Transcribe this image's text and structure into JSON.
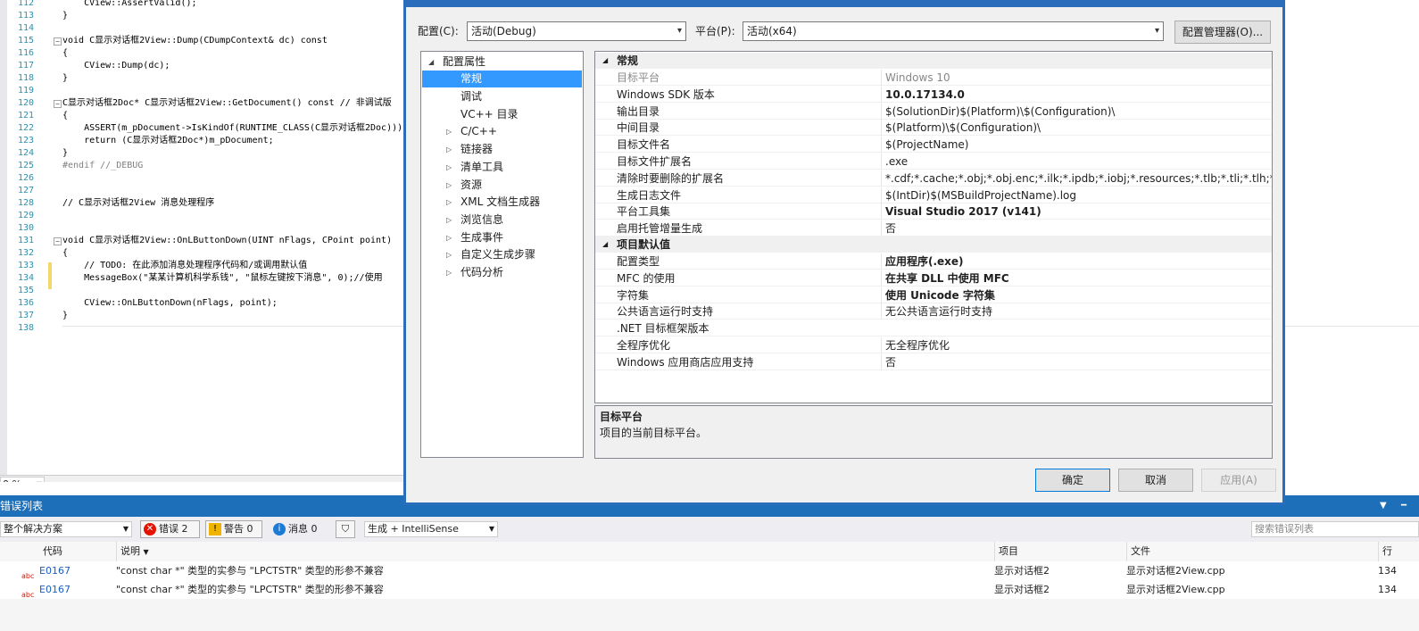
{
  "editor": {
    "lines": [
      {
        "n": "112",
        "t": "    CView::AssertValid();"
      },
      {
        "n": "113",
        "t": "}"
      },
      {
        "n": "114",
        "t": ""
      },
      {
        "n": "115",
        "t": "void C显示对话框2View::Dump(CDumpContext& dc) const"
      },
      {
        "n": "116",
        "t": "{"
      },
      {
        "n": "117",
        "t": "    CView::Dump(dc);"
      },
      {
        "n": "118",
        "t": "}"
      },
      {
        "n": "119",
        "t": ""
      },
      {
        "n": "120",
        "t": "C显示对话框2Doc* C显示对话框2View::GetDocument() const // 非调试版"
      },
      {
        "n": "121",
        "t": "{"
      },
      {
        "n": "122",
        "t": "    ASSERT(m_pDocument->IsKindOf(RUNTIME_CLASS(C显示对话框2Doc)));"
      },
      {
        "n": "123",
        "t": "    return (C显示对话框2Doc*)m_pDocument;"
      },
      {
        "n": "124",
        "t": "}"
      },
      {
        "n": "125",
        "t": "#endif //_DEBUG"
      },
      {
        "n": "126",
        "t": ""
      },
      {
        "n": "127",
        "t": ""
      },
      {
        "n": "128",
        "t": "// C显示对话框2View 消息处理程序"
      },
      {
        "n": "129",
        "t": ""
      },
      {
        "n": "130",
        "t": ""
      },
      {
        "n": "131",
        "t": "void C显示对话框2View::OnLButtonDown(UINT nFlags, CPoint point)"
      },
      {
        "n": "132",
        "t": "{"
      },
      {
        "n": "133",
        "t": "    // TODO: 在此添加消息处理程序代码和/或调用默认值"
      },
      {
        "n": "134",
        "t": "    MessageBox(\"某某计算机科学系钱\", \"鼠标左键按下消息\", 0);//使用"
      },
      {
        "n": "135",
        "t": ""
      },
      {
        "n": "136",
        "t": "    CView::OnLButtonDown(nFlags, point);"
      },
      {
        "n": "137",
        "t": "}"
      },
      {
        "n": "138",
        "t": ""
      }
    ],
    "zoom": "0 %"
  },
  "dialog": {
    "config_label": "配置(C):",
    "config_value": "活动(Debug)",
    "platform_label": "平台(P):",
    "platform_value": "活动(x64)",
    "config_manager": "配置管理器(O)...",
    "tree": [
      {
        "label": "配置属性",
        "level": 0,
        "expander": "◢"
      },
      {
        "label": "常规",
        "level": 1,
        "selected": true
      },
      {
        "label": "调试",
        "level": 1
      },
      {
        "label": "VC++ 目录",
        "level": 1
      },
      {
        "label": "C/C++",
        "level": 1,
        "expander": "▷"
      },
      {
        "label": "链接器",
        "level": 1,
        "expander": "▷"
      },
      {
        "label": "清单工具",
        "level": 1,
        "expander": "▷"
      },
      {
        "label": "资源",
        "level": 1,
        "expander": "▷"
      },
      {
        "label": "XML 文档生成器",
        "level": 1,
        "expander": "▷"
      },
      {
        "label": "浏览信息",
        "level": 1,
        "expander": "▷"
      },
      {
        "label": "生成事件",
        "level": 1,
        "expander": "▷"
      },
      {
        "label": "自定义生成步骤",
        "level": 1,
        "expander": "▷"
      },
      {
        "label": "代码分析",
        "level": 1,
        "expander": "▷"
      }
    ],
    "sections": [
      {
        "title": "常规",
        "rows": [
          {
            "name": "目标平台",
            "value": "Windows 10",
            "grey": true
          },
          {
            "name": "Windows SDK 版本",
            "value": "10.0.17134.0",
            "bold": true
          },
          {
            "name": "输出目录",
            "value": "$(SolutionDir)$(Platform)\\$(Configuration)\\"
          },
          {
            "name": "中间目录",
            "value": "$(Platform)\\$(Configuration)\\"
          },
          {
            "name": "目标文件名",
            "value": "$(ProjectName)"
          },
          {
            "name": "目标文件扩展名",
            "value": ".exe"
          },
          {
            "name": "清除时要删除的扩展名",
            "value": "*.cdf;*.cache;*.obj;*.obj.enc;*.ilk;*.ipdb;*.iobj;*.resources;*.tlb;*.tli;*.tlh;*.tmp;*.rs"
          },
          {
            "name": "生成日志文件",
            "value": "$(IntDir)$(MSBuildProjectName).log"
          },
          {
            "name": "平台工具集",
            "value": "Visual Studio 2017 (v141)",
            "bold": true
          },
          {
            "name": "启用托管增量生成",
            "value": "否"
          }
        ]
      },
      {
        "title": "项目默认值",
        "rows": [
          {
            "name": "配置类型",
            "value": "应用程序(.exe)",
            "bold": true
          },
          {
            "name": "MFC 的使用",
            "value": "在共享 DLL 中使用 MFC",
            "bold": true
          },
          {
            "name": "字符集",
            "value": "使用 Unicode 字符集",
            "bold": true
          },
          {
            "name": "公共语言运行时支持",
            "value": "无公共语言运行时支持"
          },
          {
            "name": ".NET 目标框架版本",
            "value": ""
          },
          {
            "name": "全程序优化",
            "value": "无全程序优化"
          },
          {
            "name": "Windows 应用商店应用支持",
            "value": "否"
          }
        ]
      }
    ],
    "desc_title": "目标平台",
    "desc_text": "项目的当前目标平台。",
    "ok": "确定",
    "cancel": "取消",
    "apply": "应用(A)"
  },
  "error_list": {
    "title": "错误列表",
    "scope": "整个解决方案",
    "errors_label": "错误 2",
    "warnings_label": "警告 0",
    "messages_label": "消息 0",
    "build_filter": "生成 + IntelliSense",
    "search_placeholder": "搜索错误列表",
    "columns": [
      "代码",
      "说明",
      "项目",
      "文件",
      "行"
    ],
    "rows": [
      {
        "code": "E0167",
        "desc": "\"const char *\" 类型的实参与 \"LPCTSTR\" 类型的形参不兼容",
        "project": "显示对话框2",
        "file": "显示对话框2View.cpp",
        "line": "134"
      },
      {
        "code": "E0167",
        "desc": "\"const char *\" 类型的实参与 \"LPCTSTR\" 类型的形参不兼容",
        "project": "显示对话框2",
        "file": "显示对话框2View.cpp",
        "line": "134"
      }
    ]
  },
  "colors": {
    "accent": "#1c6fb8",
    "dialog_border": "#2a6ebb",
    "selection": "#3399ff",
    "error": "#e51400"
  }
}
